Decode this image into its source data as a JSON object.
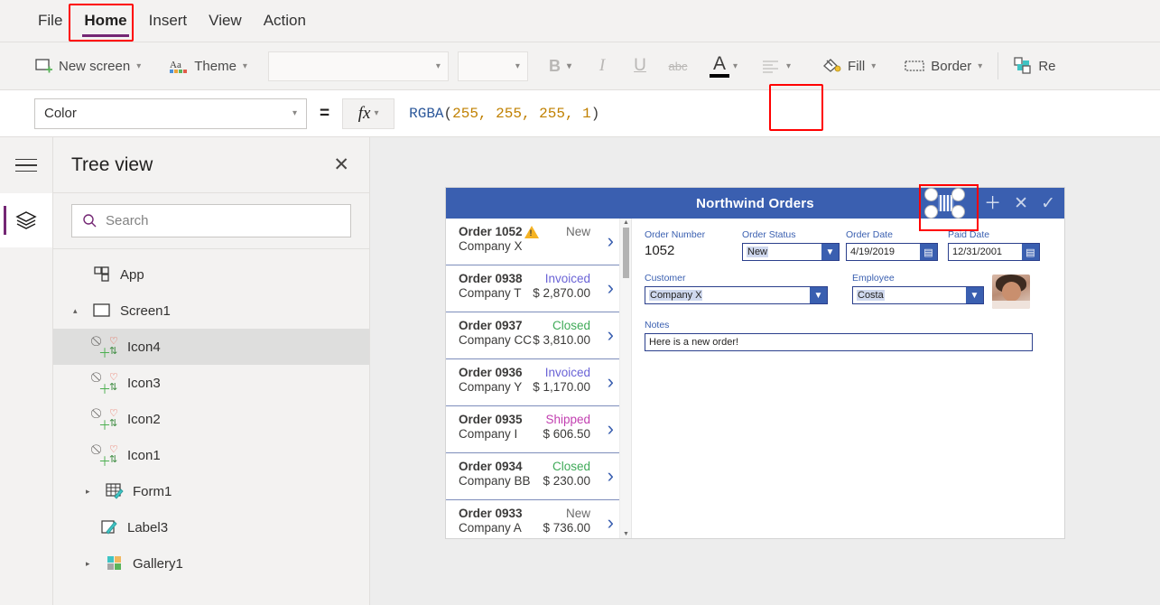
{
  "menu": {
    "items": [
      {
        "label": "File",
        "active": false
      },
      {
        "label": "Home",
        "active": true
      },
      {
        "label": "Insert",
        "active": false
      },
      {
        "label": "View",
        "active": false
      },
      {
        "label": "Action",
        "active": false
      }
    ],
    "highlight_color": "#ff0000",
    "active_underline_color": "#742774"
  },
  "toolbar": {
    "new_screen_label": "New screen",
    "theme_label": "Theme",
    "font_family_value": "",
    "font_size_value": "",
    "bold_label": "B",
    "italic_label": "I",
    "underline_label": "U",
    "strikethrough_label": "abc",
    "font_color_label": "A",
    "align_label": "align",
    "fill_label": "Fill",
    "border_label": "Border",
    "reorder_label": "Re",
    "font_color_highlighted": true
  },
  "formula_bar": {
    "property": "Color",
    "equals": "=",
    "fx_label": "fx",
    "formula_fn": "RGBA",
    "formula_open": "(",
    "formula_args": "255, 255, 255, 1",
    "formula_close": ")",
    "fn_color": "#2b579a",
    "num_color": "#c08000"
  },
  "tree_panel": {
    "title": "Tree view",
    "close_label": "✕",
    "search_placeholder": "Search",
    "items": [
      {
        "label": "App",
        "icon": "app-icon",
        "indent": 1,
        "twisty": "",
        "selected": false
      },
      {
        "label": "Screen1",
        "icon": "screen-icon",
        "indent": 1,
        "twisty": "▴",
        "selected": false
      },
      {
        "label": "Icon4",
        "icon": "icon-control-icon",
        "indent": 2,
        "twisty": "",
        "selected": true
      },
      {
        "label": "Icon3",
        "icon": "icon-control-icon",
        "indent": 2,
        "twisty": "",
        "selected": false
      },
      {
        "label": "Icon2",
        "icon": "icon-control-icon",
        "indent": 2,
        "twisty": "",
        "selected": false
      },
      {
        "label": "Icon1",
        "icon": "icon-control-icon",
        "indent": 2,
        "twisty": "",
        "selected": false
      },
      {
        "label": "Form1",
        "icon": "form-icon",
        "indent": 2,
        "twisty": "▸",
        "selected": false
      },
      {
        "label": "Label3",
        "icon": "label-icon",
        "indent": 2,
        "twisty": "",
        "selected": false
      },
      {
        "label": "Gallery1",
        "icon": "gallery-icon",
        "indent": 2,
        "twisty": "▸",
        "selected": false
      }
    ]
  },
  "canvas": {
    "app_title": "Northwind Orders",
    "header_color": "#3a5fb0",
    "header_actions": [
      {
        "name": "add-icon",
        "glyph": "＋"
      },
      {
        "name": "cancel-icon",
        "glyph": "✕"
      },
      {
        "name": "confirm-icon",
        "glyph": "✓"
      }
    ],
    "selected_element_highlight": true,
    "gallery": {
      "rows": [
        {
          "order": "Order 1052",
          "company": "Company X",
          "status": "New",
          "status_color": "#6b6b6b",
          "amount": "",
          "warning": true
        },
        {
          "order": "Order 0938",
          "company": "Company T",
          "status": "Invoiced",
          "status_color": "#6a63d6",
          "amount": "$ 2,870.00",
          "warning": false
        },
        {
          "order": "Order 0937",
          "company": "Company CC",
          "status": "Closed",
          "status_color": "#3faa58",
          "amount": "$ 3,810.00",
          "warning": false
        },
        {
          "order": "Order 0936",
          "company": "Company Y",
          "status": "Invoiced",
          "status_color": "#6a63d6",
          "amount": "$ 1,170.00",
          "warning": false
        },
        {
          "order": "Order 0935",
          "company": "Company I",
          "status": "Shipped",
          "status_color": "#c23fb0",
          "amount": "$ 606.50",
          "warning": false
        },
        {
          "order": "Order 0934",
          "company": "Company BB",
          "status": "Closed",
          "status_color": "#3faa58",
          "amount": "$ 230.00",
          "warning": false
        },
        {
          "order": "Order 0933",
          "company": "Company A",
          "status": "New",
          "status_color": "#6b6b6b",
          "amount": "$ 736.00",
          "warning": false
        }
      ],
      "chevron": "›"
    },
    "form": {
      "order_number_label": "Order Number",
      "order_number_value": "1052",
      "order_status_label": "Order Status",
      "order_status_value": "New",
      "order_date_label": "Order Date",
      "order_date_value": "4/19/2019",
      "paid_date_label": "Paid Date",
      "paid_date_value": "12/31/2001",
      "customer_label": "Customer",
      "customer_value": "Company X",
      "employee_label": "Employee",
      "employee_value": "Costa",
      "notes_label": "Notes",
      "notes_value": "Here is a new order!"
    }
  }
}
